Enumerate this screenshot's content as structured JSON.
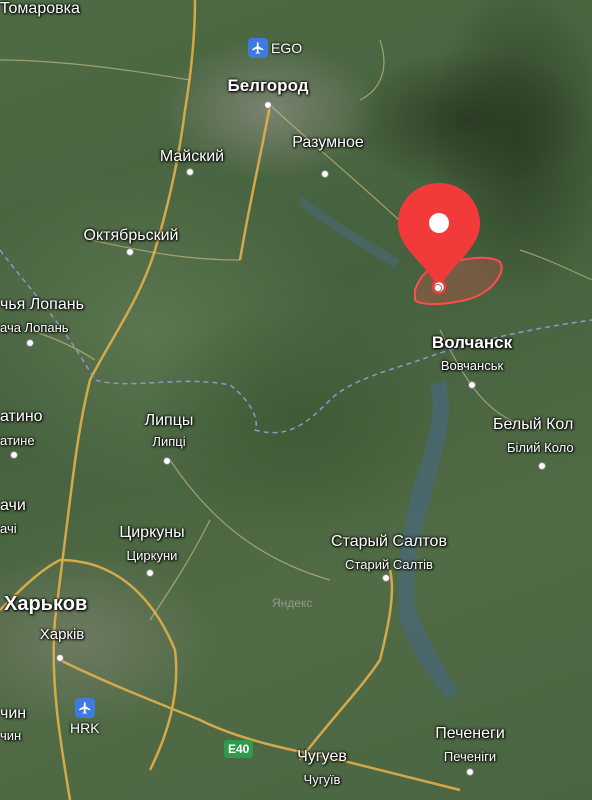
{
  "map": {
    "watermark": "Яндекс",
    "airports": [
      {
        "code": "EGO"
      },
      {
        "code": "HRK"
      }
    ],
    "highways": [
      {
        "ref": "E40"
      }
    ],
    "places": {
      "tomarovka": "Томаровка",
      "belgorod": "Белгород",
      "razumnoe": "Разумное",
      "maysky": "Майский",
      "oktyabrsky": "Октябрьский",
      "lopan_ru": "чья Лопань",
      "lopan_ua": "ача Лопань",
      "volchansk": "Волчанск",
      "volchansk_ua": "Вовчанськ",
      "lipcy": "Липцы",
      "lipcy_ua": "Липці",
      "beliy_kolodez": "Белый Кол",
      "beliy_kolodez_ua": "Білий Коло",
      "zatino": "атино",
      "zatine": "атине",
      "dergachi": "ачи",
      "dergachi_ua": "ачі",
      "cirkuny": "Циркуны",
      "cirkuni_ua": "Циркуни",
      "stariy_saltov": "Старый Салтов",
      "stariy_saltov_ua": "Старий Салтів",
      "kharkov": "Харьков",
      "kharkiv_ua": "Харків",
      "chin": "чин",
      "chin_ua": "чин",
      "chuguev": "Чугуев",
      "chuguiv_ua": "Чугуїв",
      "pechenegi": "Печенеги",
      "pechenigi_ua": "Печеніги"
    },
    "marker": {
      "color": "#f33a3a",
      "icon": "location-pin-icon"
    },
    "colors": {
      "road": "#e3b04a",
      "border": "#8f97c9",
      "zone": "#ff4d4d"
    }
  }
}
